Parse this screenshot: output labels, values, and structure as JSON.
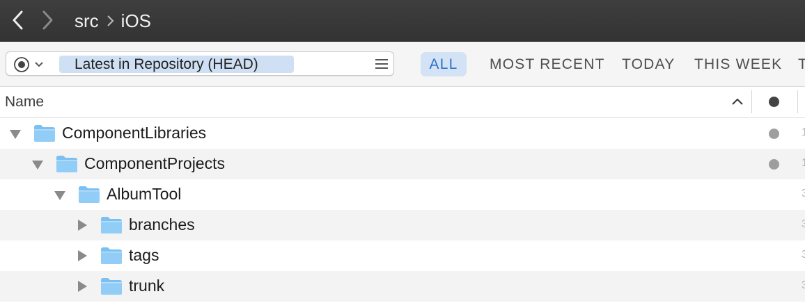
{
  "titlebar": {
    "back_icon": "chevron-left-icon",
    "forward_icon": "chevron-right-icon",
    "breadcrumb": [
      "src",
      "iOS"
    ]
  },
  "toolbar": {
    "revision_picker_icon": "radio-target-icon",
    "revision_label": "Latest in Repository (HEAD)",
    "menu_icon": "hamburger-menu-icon",
    "filters": [
      {
        "label": "ALL",
        "active": true
      },
      {
        "label": "MOST RECENT",
        "active": false
      },
      {
        "label": "TODAY",
        "active": false
      },
      {
        "label": "THIS WEEK",
        "active": false
      },
      {
        "label": "T",
        "active": false
      }
    ]
  },
  "columns": {
    "name": "Name",
    "sort_icon": "sort-ascending-chevron-icon",
    "status_icon": "status-dot-icon"
  },
  "rows": [
    {
      "name": "ComponentLibraries",
      "depth": 0,
      "expanded": true,
      "status_dot": true,
      "edge": "1"
    },
    {
      "name": "ComponentProjects",
      "depth": 1,
      "expanded": true,
      "status_dot": true,
      "edge": "1"
    },
    {
      "name": "AlbumTool",
      "depth": 2,
      "expanded": true,
      "status_dot": false,
      "edge": "3"
    },
    {
      "name": "branches",
      "depth": 3,
      "expanded": false,
      "status_dot": false,
      "edge": "3"
    },
    {
      "name": "tags",
      "depth": 3,
      "expanded": false,
      "status_dot": false,
      "edge": "3"
    },
    {
      "name": "trunk",
      "depth": 3,
      "expanded": false,
      "status_dot": false,
      "edge": "3"
    }
  ],
  "colors": {
    "titlebar": "#383838",
    "accent": "#2c72c7",
    "accent_bg": "#d3e2f5",
    "folder": "#7cc0f1",
    "status_dot": "#9e9e9e"
  }
}
